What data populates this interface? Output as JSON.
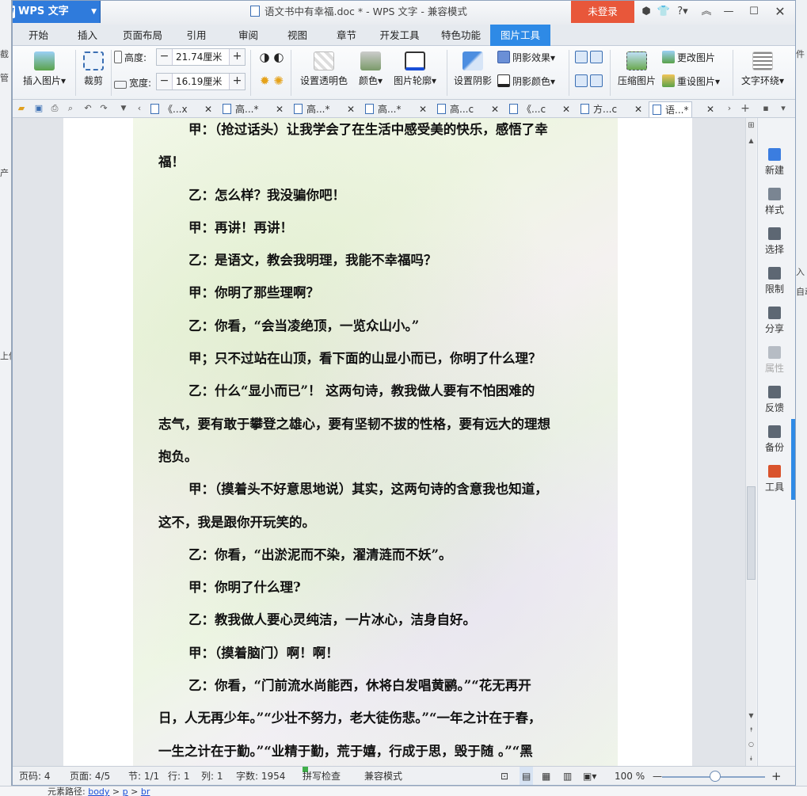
{
  "app": {
    "name": "WPS 文字",
    "window_title": "语文书中有幸福.doc * - WPS 文字 - 兼容模式",
    "login_label": "未登录"
  },
  "background_window": {
    "left_fragments": [
      "截",
      "管",
      "产",
      "上传"
    ],
    "right_fragments": [
      "件",
      "入",
      "自动"
    ],
    "element_path_label": "元素路径:",
    "element_path_links": [
      "body",
      "p",
      "br"
    ]
  },
  "menu_tabs": [
    {
      "label": "开始"
    },
    {
      "label": "插入"
    },
    {
      "label": "页面布局"
    },
    {
      "label": "引用"
    },
    {
      "label": "审阅"
    },
    {
      "label": "视图"
    },
    {
      "label": "章节"
    },
    {
      "label": "开发工具"
    },
    {
      "label": "特色功能"
    },
    {
      "label": "图片工具"
    }
  ],
  "ribbon": {
    "insert_picture": "插入图片",
    "crop": "裁剪",
    "height_label": "高度:",
    "height_value": "21.74厘米",
    "width_label": "宽度:",
    "width_value": "16.19厘米",
    "set_transparent": "设置透明色",
    "color": "颜色",
    "picture_outline": "图片轮廓",
    "set_shadow": "设置阴影",
    "shadow_effect": "阴影效果",
    "shadow_color": "阴影颜色",
    "compress_picture": "压缩图片",
    "change_picture": "更改图片",
    "reset_picture": "重设图片",
    "text_wrap": "文字环绕"
  },
  "doc_tabs": [
    {
      "label": "《...x"
    },
    {
      "label": "高...*"
    },
    {
      "label": "高...*"
    },
    {
      "label": "高...*"
    },
    {
      "label": "高...c"
    },
    {
      "label": "《...c"
    },
    {
      "label": "方...c"
    },
    {
      "label": "语...*"
    }
  ],
  "document": {
    "paragraphs": [
      {
        "text": "甲：（抢过话头）让我学会了在生活中感受美的快乐，感悟了幸",
        "cont": false
      },
      {
        "text": "福！",
        "cont": true
      },
      {
        "text": "乙：怎么样？我没骗你吧！",
        "cont": false
      },
      {
        "text": "甲：再讲！再讲！",
        "cont": false
      },
      {
        "text": "乙：是语文，教会我明理，我能不幸福吗？",
        "cont": false
      },
      {
        "text": "甲：你明了那些理啊？",
        "cont": false
      },
      {
        "text": "乙：你看，“会当凌绝顶，一览众山小。”",
        "cont": false
      },
      {
        "text": "甲；只不过站在山顶，看下面的山显小而已，你明了什么理？",
        "cont": false
      },
      {
        "text": "乙：什么“显小而已”！ 这两句诗，教我做人要有不怕困难的",
        "cont": false
      },
      {
        "text": "志气，要有敢于攀登之雄心，要有坚韧不拔的性格，要有远大的理想",
        "cont": true
      },
      {
        "text": "抱负。",
        "cont": true
      },
      {
        "text": "甲：（摸着头不好意思地说）其实，这两句诗的含意我也知道，",
        "cont": false
      },
      {
        "text": "这不，我是跟你开玩笑的。",
        "cont": true
      },
      {
        "text": "乙：你看，“出淤泥而不染，濯清涟而不妖”。",
        "cont": false
      },
      {
        "text": "甲：你明了什么理?",
        "cont": false
      },
      {
        "text": "乙：教我做人要心灵纯洁，一片冰心，洁身自好。",
        "cont": false
      },
      {
        "text": "甲：（摸着脑门）啊！啊！",
        "cont": false
      },
      {
        "text": "乙：你看，“门前流水尚能西，休将白发唱黄鹂。”“花无再开",
        "cont": false
      },
      {
        "text": "日，人无再少年。”“少壮不努力，老大徒伤悲。”“一年之计在于春，",
        "cont": true
      },
      {
        "text": "一生之计在于勤。”“业精于勤，荒于嬉，行成于思，毁于随 。”“黑",
        "cont": true
      }
    ]
  },
  "right_panel": [
    {
      "label": "新建",
      "color": "#3b7de0",
      "disabled": false
    },
    {
      "label": "样式",
      "color": "#7a8592",
      "disabled": false
    },
    {
      "label": "选择",
      "color": "#5d6773",
      "disabled": false
    },
    {
      "label": "限制",
      "color": "#5d6773",
      "disabled": false
    },
    {
      "label": "分享",
      "color": "#5d6773",
      "disabled": false
    },
    {
      "label": "属性",
      "color": "#b6bcc4",
      "disabled": true
    },
    {
      "label": "反馈",
      "color": "#5d6773",
      "disabled": false
    },
    {
      "label": "备份",
      "color": "#5d6773",
      "disabled": false
    },
    {
      "label": "工具",
      "color": "#d9532c",
      "disabled": false
    }
  ],
  "status": {
    "page_code": "页码: 4",
    "pages": "页面: 4/5",
    "section": "节: 1/1",
    "row": "行: 1",
    "col": "列: 1",
    "word_count": "字数: 1954",
    "spell_check": "拼写检查",
    "compat_mode": "兼容模式",
    "zoom": "100 %"
  },
  "colors": {
    "accent": "#2e8ae6",
    "login": "#e8573a",
    "app_button": "#2f7bdc"
  }
}
